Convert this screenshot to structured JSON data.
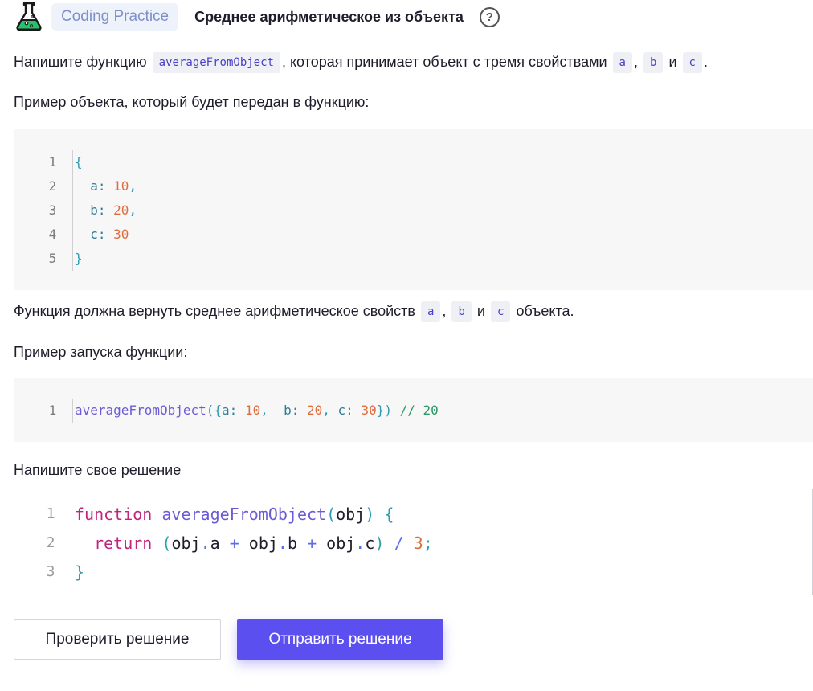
{
  "header": {
    "badge": "Coding Practice",
    "title": "Среднее арифметическое из объекта",
    "help": "?"
  },
  "intro": {
    "before": "Напишите функцию",
    "fn": "averageFromObject",
    "middle": ", которая принимает объект с тремя свойствами",
    "a": "a",
    "comma": ",",
    "b": "b",
    "and": "и",
    "c": "c",
    "end": "."
  },
  "example_label": "Пример объекта, который будет передан в функцию:",
  "object_example": {
    "line_numbers": [
      "1",
      "2",
      "3",
      "4",
      "5"
    ],
    "open": "{",
    "rows": [
      {
        "key": "a:",
        "value": "10",
        "sep": ","
      },
      {
        "key": "b:",
        "value": "20",
        "sep": ","
      },
      {
        "key": "c:",
        "value": "30",
        "sep": ""
      }
    ],
    "close": "}"
  },
  "return_text": {
    "before": "Функция должна вернуть среднее арифметическое свойств",
    "a": "a",
    "comma": ",",
    "b": "b",
    "and": "и",
    "c": "c",
    "after": "объекта."
  },
  "run_label": "Пример запуска функции:",
  "run_example": {
    "line_number": "1",
    "fn": "averageFromObject",
    "open": "({",
    "a_key": "a:",
    "a_val": "10",
    "sep1": ",  ",
    "b_key": "b:",
    "b_val": "20",
    "sep2": ", ",
    "c_key": "c:",
    "c_val": "30",
    "close": "})",
    "comment": " // 20"
  },
  "solution_label": "Напишите свое решение",
  "editor": {
    "line_numbers": [
      "1",
      "2",
      "3"
    ],
    "l1_kw": "function",
    "l1_fn": "averageFromObject",
    "l1_open": "(",
    "l1_arg": "obj",
    "l1_close": ")",
    "l1_brace": "{",
    "l2_kw": "return",
    "l2_open": "(",
    "l2_o1": "obj",
    "l2_d1": ".",
    "l2_p1": "a",
    "l2_plus1": "+",
    "l2_o2": "obj",
    "l2_d2": ".",
    "l2_p2": "b",
    "l2_plus2": "+",
    "l2_o3": "obj",
    "l2_d3": ".",
    "l2_p3": "c",
    "l2_close": ")",
    "l2_div": "/",
    "l2_num": "3",
    "l2_semi": ";",
    "l3_brace": "}"
  },
  "buttons": {
    "check": "Проверить решение",
    "submit": "Отправить решение"
  },
  "colors": {
    "accent": "#5b4ff0",
    "badge_bg": "#eef2fb",
    "code_bg": "#f7f7f8"
  },
  "icons": {
    "logo": "flask-icon",
    "help": "question-circle-icon"
  }
}
